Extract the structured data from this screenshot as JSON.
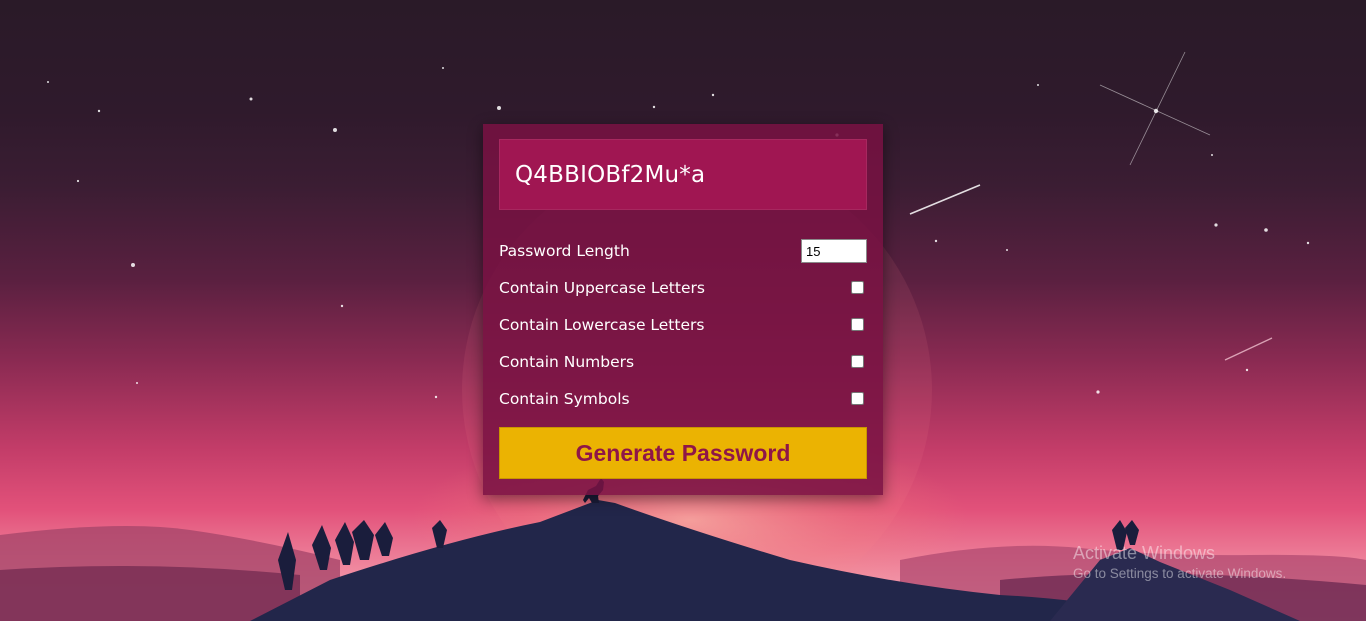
{
  "generator": {
    "password": "Q4BBIOBf2Mu*a",
    "length_label": "Password Length",
    "length_value": "15",
    "options": [
      {
        "label": "Contain Uppercase Letters",
        "checked": false
      },
      {
        "label": "Contain Lowercase Letters",
        "checked": false
      },
      {
        "label": "Contain Numbers",
        "checked": false
      },
      {
        "label": "Contain Symbols",
        "checked": false
      }
    ],
    "button_label": "Generate Password"
  },
  "watermark": {
    "title": "Activate Windows",
    "subtitle": "Go to Settings to activate Windows."
  },
  "colors": {
    "card_bg": "#78124299",
    "display_bg": "#a01652",
    "button_bg": "#ebb302",
    "button_text": "#8f1648"
  }
}
